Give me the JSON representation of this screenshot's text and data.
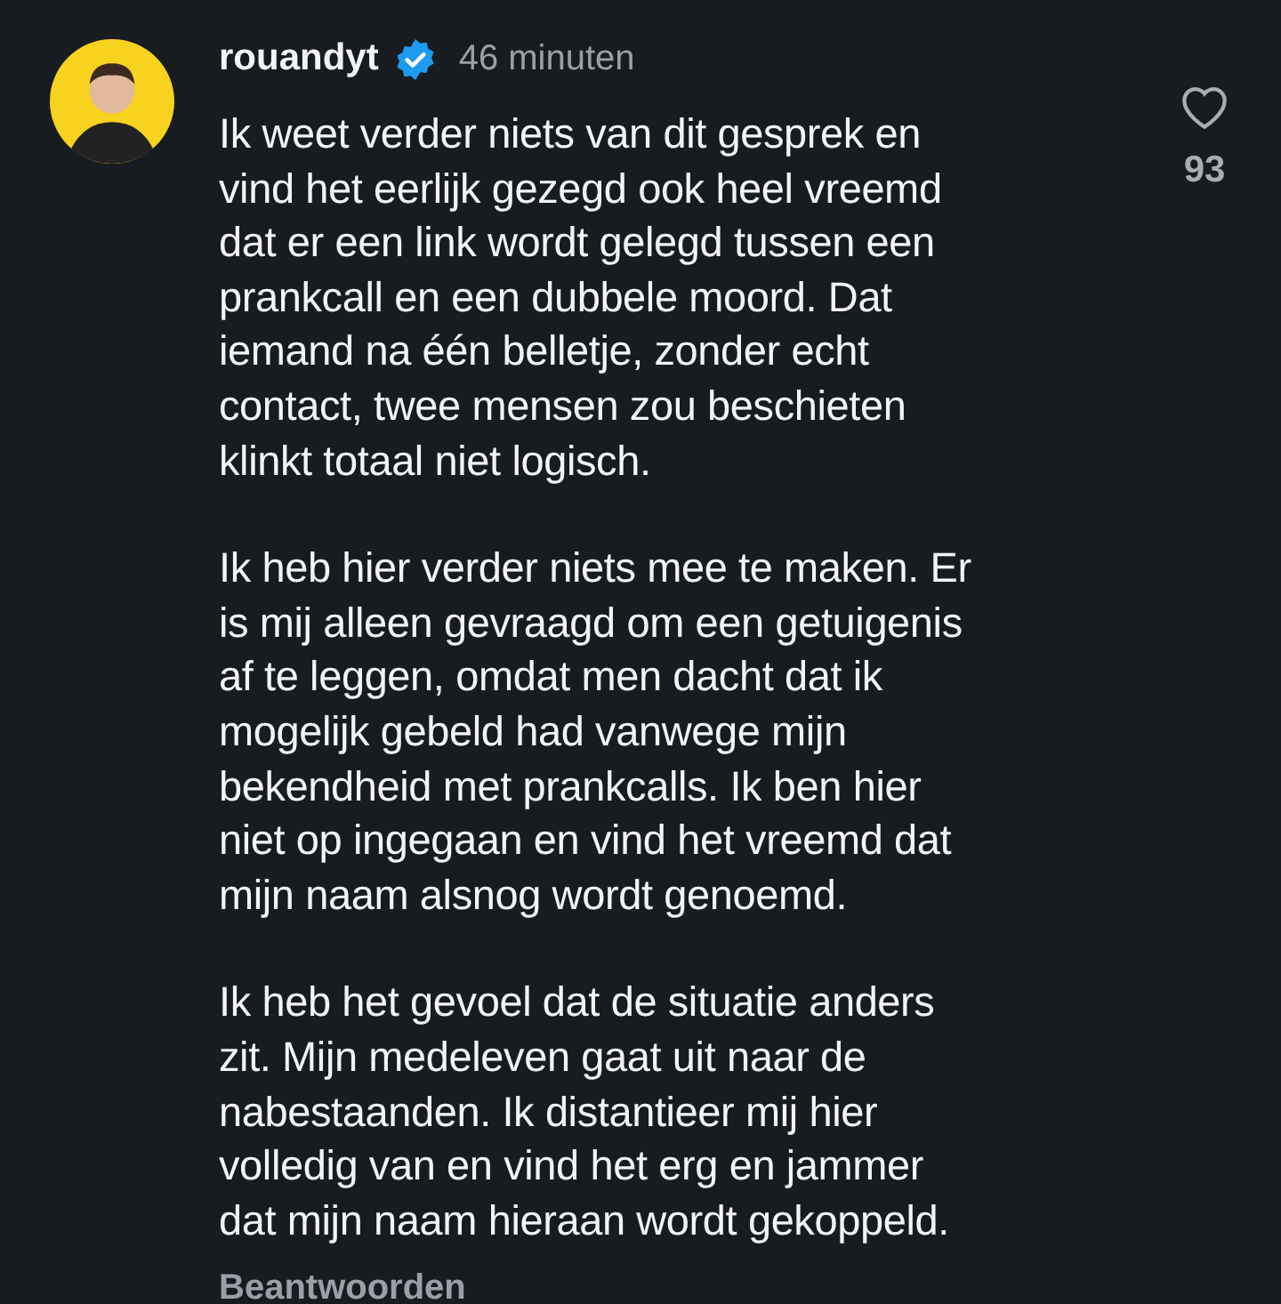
{
  "comment": {
    "username": "rouandyt",
    "verified": true,
    "time": "46 minuten",
    "paragraphs": [
      [
        "Ik weet verder niets van dit gesprek en",
        "vind het eerlijk gezegd ook heel vreemd",
        "dat er een link wordt gelegd tussen een",
        "prankcall en een dubbele moord. Dat",
        "iemand na één belletje, zonder echt",
        "contact, twee mensen zou beschieten",
        "klinkt totaal niet logisch."
      ],
      [
        "Ik heb hier verder niets mee te maken. Er",
        "is mij alleen gevraagd om een getuigenis",
        "af te leggen, omdat men dacht dat ik",
        "mogelijk gebeld had vanwege mijn",
        "bekendheid met prankcalls. Ik ben hier",
        "niet op ingegaan en vind het vreemd dat",
        "mijn naam alsnog wordt genoemd."
      ],
      [
        "Ik heb het gevoel dat de situatie anders",
        "zit. Mijn medeleven gaat uit naar de",
        "nabestaanden. Ik distantieer mij hier",
        "volledig van en vind het erg en jammer",
        "dat mijn naam hieraan wordt gekoppeld."
      ]
    ],
    "reply": "Beantwoorden",
    "likes": "93",
    "liked": false
  }
}
